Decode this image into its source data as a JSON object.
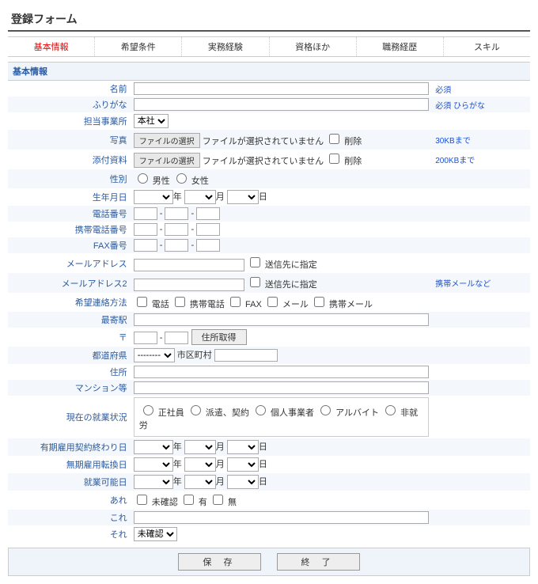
{
  "page_title": "登録フォーム",
  "tabs": [
    {
      "label": "基本情報",
      "active": true
    },
    {
      "label": "希望条件",
      "active": false
    },
    {
      "label": "実務経験",
      "active": false
    },
    {
      "label": "資格ほか",
      "active": false
    },
    {
      "label": "職務経歴",
      "active": false
    },
    {
      "label": "スキル",
      "active": false
    }
  ],
  "section_header": "基本情報",
  "labels": {
    "name": "名前",
    "kana": "ふりがな",
    "office": "担当事業所",
    "photo": "写真",
    "attachment": "添付資料",
    "gender": "性別",
    "birth": "生年月日",
    "tel": "電話番号",
    "mobile": "携帯電話番号",
    "fax": "FAX番号",
    "email": "メールアドレス",
    "email2": "メールアドレス2",
    "contact_pref": "希望連絡方法",
    "station": "最寄駅",
    "zip": "〒",
    "pref": "都道府県",
    "addr": "住所",
    "mansion": "マンション等",
    "employment": "現在の就業状況",
    "fixed_term_end": "有期雇用契約終わり日",
    "indef_transfer": "無期雇用転換日",
    "avail_date": "就業可能日",
    "are": "あれ",
    "kore": "これ",
    "sore": "それ"
  },
  "hints": {
    "name": "必須",
    "kana": "必須 ひらがな",
    "photo": "30KBまで",
    "attachment": "200KBまで",
    "email2": "携帯メールなど"
  },
  "file": {
    "choose": "ファイルの選択",
    "none": "ファイルが選択されていません",
    "delete": "削除"
  },
  "gender": {
    "male": "男性",
    "female": "女性"
  },
  "date": {
    "year": "年",
    "month": "月",
    "day": "日"
  },
  "office_selected": "本社",
  "sendto": "送信先に指定",
  "contact_opts": {
    "tel": "電話",
    "mobile": "携帯電話",
    "fax": "FAX",
    "mail": "メール",
    "mmail": "携帯メール"
  },
  "zip_btn": "住所取得",
  "pref_placeholder": "--------",
  "pref_city": "市区町村",
  "employment_opts": {
    "fulltime": "正社員",
    "dispatch": "派遣、契約",
    "sole": "個人事業者",
    "part": "アルバイト",
    "none": "非就労"
  },
  "are_opts": {
    "unconfirmed": "未確認",
    "yes": "有",
    "no": "無"
  },
  "sore_selected": "未確認",
  "footer": {
    "save": "保 存",
    "close": "終 了"
  }
}
